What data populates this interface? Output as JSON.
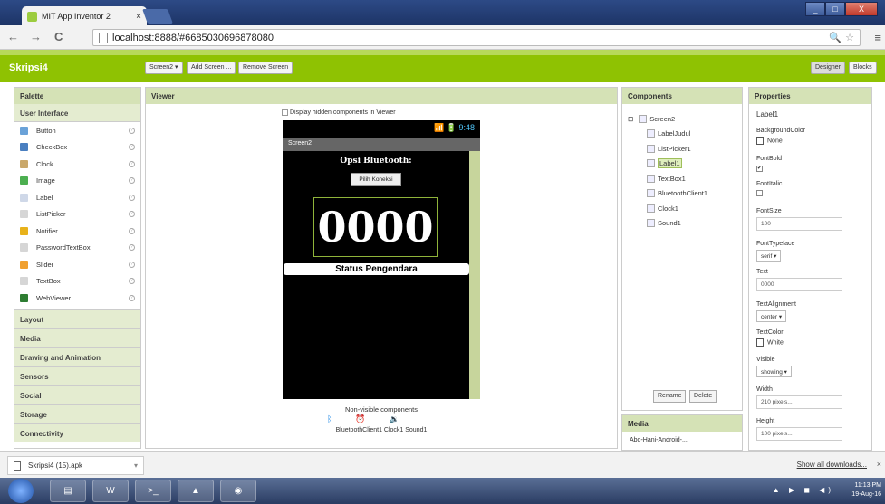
{
  "browser": {
    "tab_title": "MIT App Inventor 2",
    "tab_close": "×",
    "url": "localhost:8888/#6685030696878080",
    "zoom_glyph": "🔍",
    "star_glyph": "☆",
    "menu_glyph": "≡",
    "back": "←",
    "forward": "→",
    "reload": "C"
  },
  "app": {
    "project_name": "Skripsi4",
    "screen_select": "Screen2 ▾",
    "add_screen": "Add Screen ...",
    "remove_screen": "Remove Screen",
    "designer": "Designer",
    "blocks": "Blocks"
  },
  "palette": {
    "title": "Palette",
    "section": "User Interface",
    "items": [
      {
        "label": "Button",
        "color": "#6aa2d8"
      },
      {
        "label": "CheckBox",
        "color": "#4a7fc0"
      },
      {
        "label": "Clock",
        "color": "#c9a86b"
      },
      {
        "label": "Image",
        "color": "#4caf50"
      },
      {
        "label": "Label",
        "color": "#cfd8e8"
      },
      {
        "label": "ListPicker",
        "color": "#d6d6d6"
      },
      {
        "label": "Notifier",
        "color": "#e8b21b"
      },
      {
        "label": "PasswordTextBox",
        "color": "#d6d6d6"
      },
      {
        "label": "Slider",
        "color": "#f0a030"
      },
      {
        "label": "TextBox",
        "color": "#d6d6d6"
      },
      {
        "label": "WebViewer",
        "color": "#2e7d32"
      }
    ],
    "help_glyph": "?",
    "categories": [
      "Layout",
      "Media",
      "Drawing and Animation",
      "Sensors",
      "Social",
      "Storage",
      "Connectivity"
    ]
  },
  "viewer": {
    "title": "Viewer",
    "hidden_checkbox_label": "Display hidden components in Viewer",
    "phone_status": "📶 🔋 9:48",
    "screen_title": "Screen2",
    "opsi_label": "Opsi Bluetooth:",
    "pilih_button": "Pilih Koneksi",
    "big_number": "0000",
    "status_label": "Status Pengendara",
    "nonvisible_title": "Non-visible components",
    "nonvisible_labels": "BluetoothClient1 Clock1 Sound1"
  },
  "components": {
    "title": "Components",
    "root": "Screen2",
    "collapse_glyph": "⊟",
    "children": [
      "LabelJudul",
      "ListPicker1",
      "Label1",
      "TextBox1",
      "BluetoothClient1",
      "Clock1",
      "Sound1"
    ],
    "selected": "Label1",
    "rename": "Rename",
    "delete": "Delete"
  },
  "media": {
    "title": "Media",
    "item": "Abo-Hani-Android-..."
  },
  "properties": {
    "title": "Properties",
    "component": "Label1",
    "background_color_label": "BackgroundColor",
    "background_color_value": "None",
    "fontbold_label": "FontBold",
    "fontbold_check": "✔",
    "fontitalic_label": "FontItalic",
    "fontsize_label": "FontSize",
    "fontsize_value": "100",
    "fonttypeface_label": "FontTypeface",
    "fonttypeface_value": "serif ▾",
    "text_label": "Text",
    "text_value": "0000",
    "textalignment_label": "TextAlignment",
    "textalignment_value": "center ▾",
    "textcolor_label": "TextColor",
    "textcolor_value": "White",
    "visible_label": "Visible",
    "visible_value": "showing ▾",
    "width_label": "Width",
    "width_value": "210 pixels...",
    "height_label": "Height",
    "height_value": "100 pixels..."
  },
  "downloads": {
    "file": "Skripsi4 (15).apk",
    "dropdown": "▾",
    "show_all": "Show all downloads...",
    "close": "×"
  },
  "taskbar": {
    "time": "11:13 PM",
    "date": "19-Aug-16",
    "tray_icons": "▲ ▶ ◼ ◀)"
  }
}
